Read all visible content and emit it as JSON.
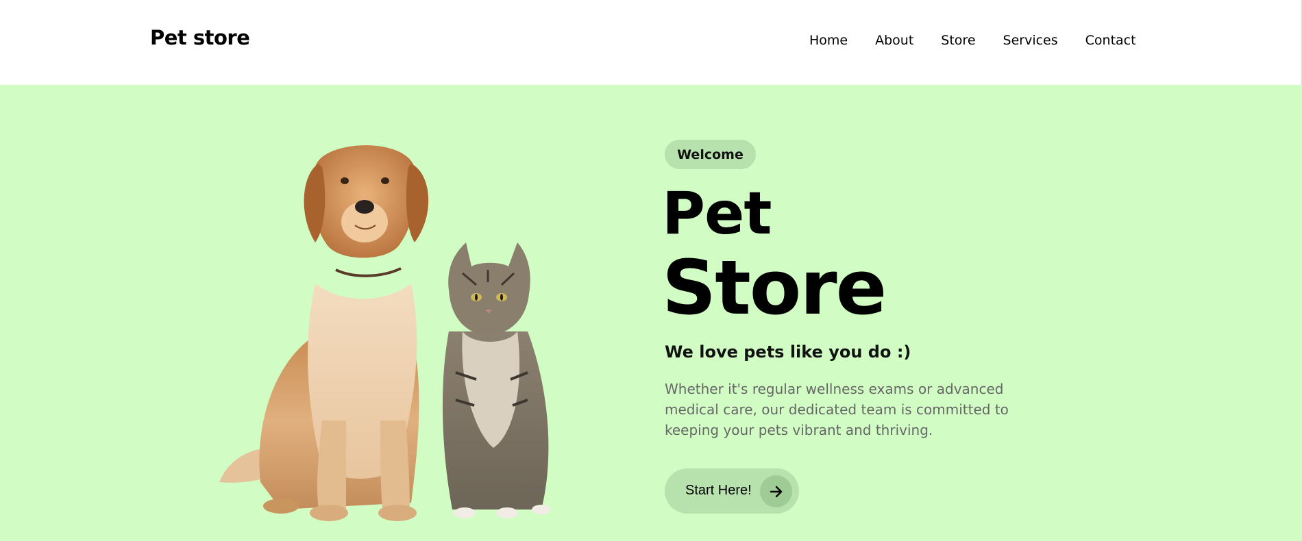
{
  "header": {
    "brand": "Pet store",
    "nav": [
      {
        "label": "Home"
      },
      {
        "label": "About"
      },
      {
        "label": "Store"
      },
      {
        "label": "Services"
      },
      {
        "label": "Contact"
      }
    ]
  },
  "hero": {
    "badge": "Welcome",
    "title_line1": "Pet",
    "title_line2": "Store",
    "subtitle": "We love pets like you do :)",
    "description": "Whether it's regular wellness exams or advanced medical care, our dedicated team is committed to keeping your pets vibrant and thriving.",
    "cta_label": "Start Here!",
    "cta_icon": "arrow-right-icon",
    "image": "dog-and-cat-photo"
  },
  "colors": {
    "hero_background": "#d1fdc4",
    "pill_background": "#b8e2ad",
    "cta_icon_background": "#9fcc94",
    "description_text": "#666666"
  }
}
